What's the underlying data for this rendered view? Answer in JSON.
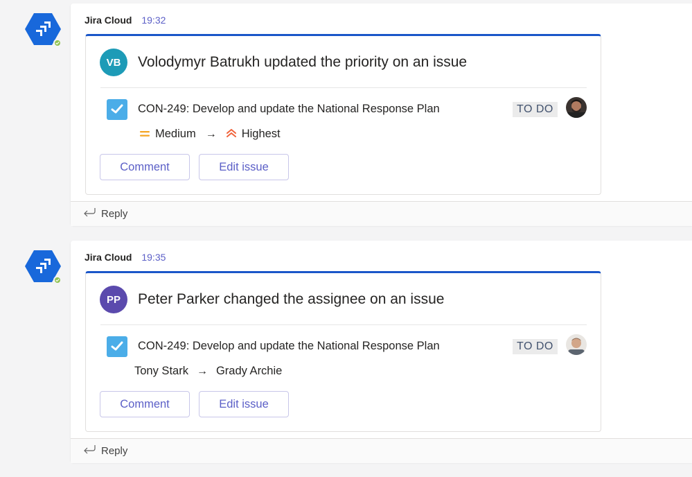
{
  "messages": [
    {
      "sender": "Jira Cloud",
      "time": "19:32",
      "card": {
        "actor_initials": "VB",
        "actor_color": "#1d9bb7",
        "title": "Volodymyr Batrukh updated the priority on an issue",
        "issue": "CON-249: Develop and update the National Response Plan",
        "status": "TO DO",
        "change_from": "Medium",
        "change_to": "Highest",
        "buttons": {
          "comment": "Comment",
          "edit": "Edit issue"
        }
      },
      "reply_label": "Reply"
    },
    {
      "sender": "Jira Cloud",
      "time": "19:35",
      "card": {
        "actor_initials": "PP",
        "actor_color": "#5b4aad",
        "title": "Peter Parker changed the assignee on an issue",
        "issue": "CON-249: Develop and update the National Response Plan",
        "status": "TO DO",
        "change_from": "Tony Stark",
        "change_to": "Grady Archie",
        "buttons": {
          "comment": "Comment",
          "edit": "Edit issue"
        }
      },
      "reply_label": "Reply"
    }
  ],
  "icons": {
    "app": "jira-logo-icon",
    "presence": "available-check-icon",
    "task": "checkbox-task-icon",
    "priority_medium": "priority-medium-icon",
    "priority_highest": "priority-highest-icon",
    "arrow": "arrow-right-icon",
    "reply": "reply-arrow-icon"
  },
  "colors": {
    "accent": "#5b5fc7",
    "card_border_top": "#1a56c9",
    "jira_blue": "#1868db",
    "task_blue": "#4bade8",
    "priority_medium": "#f5a623",
    "priority_highest": "#f0643c",
    "presence_green": "#92c353"
  }
}
